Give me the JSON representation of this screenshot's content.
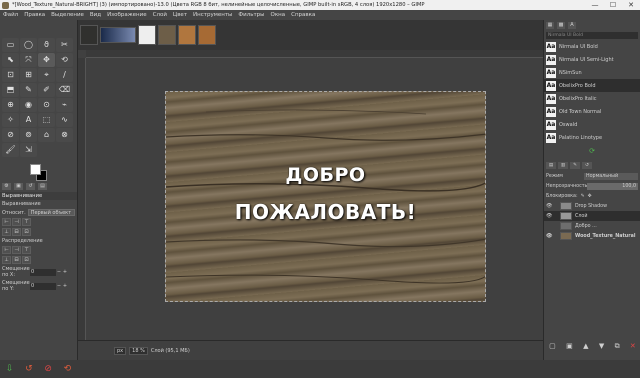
{
  "window": {
    "title": "*[Wood_Texture_Natural-BRIGHT] (3) (импортировано)-13.0 (Цвета RGB 8 бит, нелинейные целочисленные, GIMP built-in sRGB, 4 слоя) 1920x1280 – GIMP",
    "minimize": "—",
    "maximize": "☐",
    "close": "✕"
  },
  "menu": [
    "Файл",
    "Правка",
    "Выделение",
    "Вид",
    "Изображение",
    "Слой",
    "Цвет",
    "Инструменты",
    "Фильтры",
    "Окна",
    "Справка"
  ],
  "tools": [
    "▭",
    "◯",
    "ϑ",
    "✂",
    "⬉",
    "⤧",
    "✥",
    "⟲",
    "⊡",
    "⊞",
    "⌖",
    "∕",
    "⬒",
    "✎",
    "✐",
    "⌫",
    "⊕",
    "◉",
    "⊙",
    "⌁",
    "✧",
    "A",
    "⬚",
    "∿",
    "⊘",
    "⊚",
    "⌂",
    "⊗",
    "🖌",
    "⇲"
  ],
  "left_panel": {
    "title": "Выравнивание",
    "subtitle": "Выравнивание",
    "relative_label": "Относит.",
    "relative_value": "Первый объект",
    "align_buttons": [
      "⊢",
      "⊣",
      "⊤",
      "⊥",
      "⊟",
      "⊡"
    ],
    "distribute_label": "Распределение",
    "distribute_buttons": [
      "⊢",
      "⊣",
      "⊤",
      "⊥",
      "⊟",
      "⊡"
    ],
    "offset_x_label": "Смещение по X:",
    "offset_x_value": "0",
    "offset_y_label": "Смещение по Y:",
    "offset_y_value": "0"
  },
  "canvas": {
    "text_line1": "ДОБРО",
    "text_line2": "ПОЖАЛОВАТЬ!"
  },
  "status": {
    "unit": "px",
    "zoom": "18 %",
    "info": "Слой (95,1 МБ)"
  },
  "fonts": {
    "filter_placeholder": "Nirmala UI Bold",
    "items": [
      {
        "name": "Nirmala UI Bold"
      },
      {
        "name": "Nirmala UI Semi-Light"
      },
      {
        "name": "NSimSun"
      },
      {
        "name": "ObelixPro Bold"
      },
      {
        "name": "ObelixPro Italic"
      },
      {
        "name": "Old Town Normal"
      },
      {
        "name": "Oswald"
      },
      {
        "name": "Palatino Linotype"
      }
    ],
    "selected_index": 3
  },
  "layers": {
    "mode_label": "Режим",
    "mode_value": "Нормальный",
    "opacity_label": "Непрозрачность",
    "opacity_value": "100,0",
    "lock_label": "Блокировка:",
    "items": [
      {
        "name": "Drop Shadow",
        "visible": true
      },
      {
        "name": "Слой",
        "visible": true
      },
      {
        "name": "Добро ...",
        "visible": false
      },
      {
        "name": "Wood_Texture_Natural",
        "visible": true
      }
    ]
  }
}
